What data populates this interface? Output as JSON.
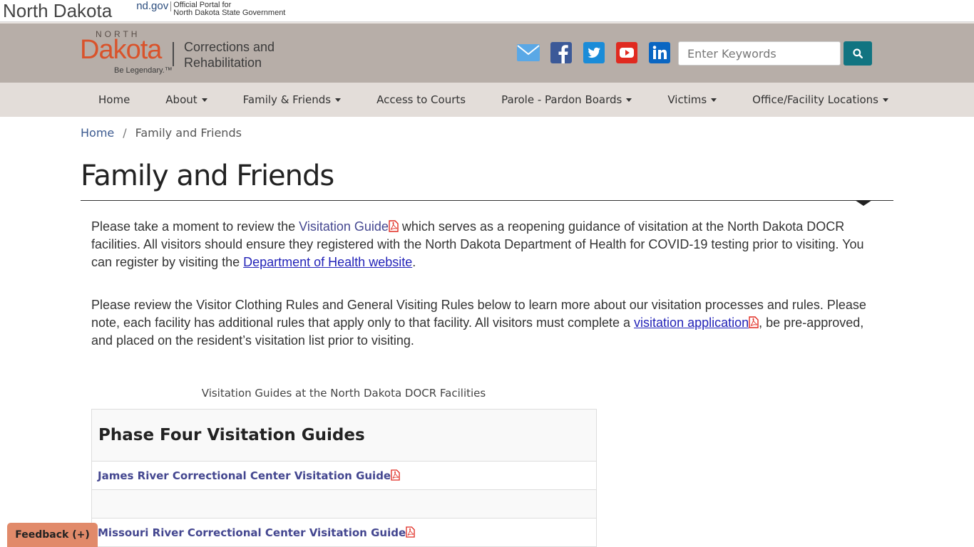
{
  "statebar": {
    "state": "North Dakota",
    "ndgov": "nd.gov",
    "official_line1": "Official Portal for",
    "official_line2": "North Dakota State Government"
  },
  "logo": {
    "north": "NORTH",
    "dakota": "Dakota",
    "legendary": "Be Legendary.™",
    "dept_line1": "Corrections and",
    "dept_line2": "Rehabilitation"
  },
  "social": [
    {
      "icon": "email-icon",
      "color": "#5aa8e6"
    },
    {
      "icon": "facebook-icon",
      "color": "#3b5998"
    },
    {
      "icon": "twitter-icon",
      "color": "#1a8cd8"
    },
    {
      "icon": "youtube-icon",
      "color": "#e02a20"
    },
    {
      "icon": "linkedin-icon",
      "color": "#0a66c2"
    }
  ],
  "search": {
    "placeholder": "Enter Keywords",
    "button_icon": "search-icon",
    "button_color": "#117481"
  },
  "nav": {
    "items": [
      {
        "label": "Home",
        "dropdown": false
      },
      {
        "label": "About",
        "dropdown": true
      },
      {
        "label": "Family & Friends",
        "dropdown": true
      },
      {
        "label": "Access to Courts",
        "dropdown": false
      },
      {
        "label": "Parole - Pardon Boards",
        "dropdown": true
      },
      {
        "label": "Victims",
        "dropdown": true
      },
      {
        "label": "Office/Facility Locations",
        "dropdown": true
      }
    ]
  },
  "breadcrumb": {
    "home": "Home",
    "separator": "/",
    "current": "Family and Friends"
  },
  "page": {
    "title": "Family and Friends",
    "p1_a": "Please take a moment to review the ",
    "p1_link": "Visitation Guide",
    "p1_b": " which serves as a reopening guidance of visitation at the North Dakota DOCR facilities. All visitors should ensure they registered with the North Dakota Department of Health for COVID-19 testing prior to visiting. You can register by visiting the ",
    "p1_link2": "Department of Health website",
    "p1_c": ".",
    "p2_a": "Please review the Visitor Clothing Rules and General Visiting Rules below to learn more about our visitation processes and rules. Please note, each facility has additional rules that apply only to that facility. All visitors must complete a ",
    "p2_link": "visitation application",
    "p2_b": ", be pre-approved, and placed on the resident’s visitation list prior to visiting."
  },
  "table": {
    "caption": "Visitation Guides at the North Dakota DOCR Facilities",
    "heading": "Phase Four Visitation Guides",
    "rows": [
      "James River Correctional Center Visitation Guide",
      "",
      "Missouri River Correctional Center Visitation Guide"
    ]
  },
  "feedback": {
    "label": "Feedback (+)"
  }
}
